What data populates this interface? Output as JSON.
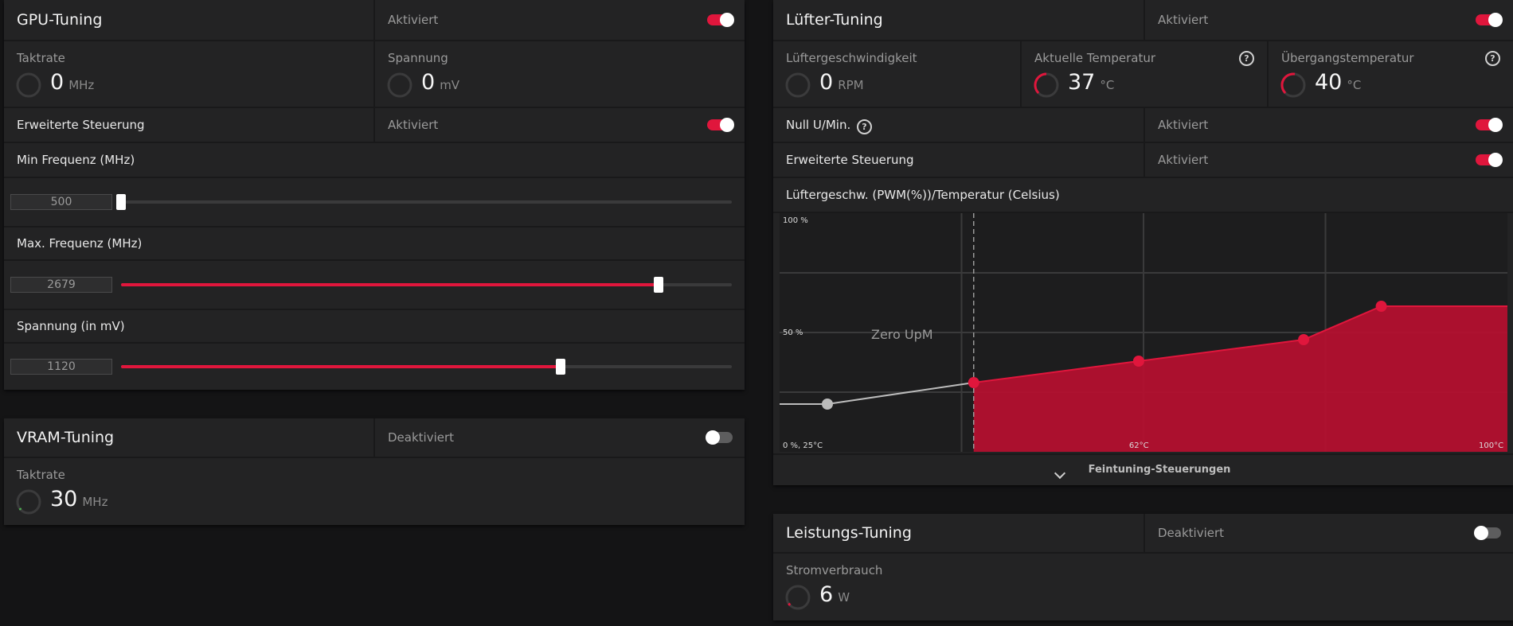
{
  "gpu": {
    "title": "GPU-Tuning",
    "status": "Aktiviert",
    "clock_label": "Taktrate",
    "clock_value": "0",
    "clock_unit": "MHz",
    "voltage_label": "Spannung",
    "voltage_value": "0",
    "voltage_unit": "mV",
    "advanced_label": "Erweiterte Steuerung",
    "advanced_status": "Aktiviert",
    "min_freq_label": "Min Frequenz (MHz)",
    "min_freq_value": "500",
    "min_freq_fraction": 0.0,
    "max_freq_label": "Max. Frequenz (MHz)",
    "max_freq_value": "2679",
    "max_freq_fraction": 0.88,
    "volt_slider_label": "Spannung (in mV)",
    "volt_slider_value": "1120",
    "volt_slider_fraction": 0.72
  },
  "vram": {
    "title": "VRAM-Tuning",
    "status": "Deaktiviert",
    "clock_label": "Taktrate",
    "clock_value": "30",
    "clock_unit": "MHz"
  },
  "fan": {
    "title": "Lüfter-Tuning",
    "status": "Aktiviert",
    "speed_label": "Lüftergeschwindigkeit",
    "speed_value": "0",
    "speed_unit": "RPM",
    "temp_label": "Aktuelle Temperatur",
    "temp_value": "37",
    "temp_unit": "°C",
    "junction_label": "Übergangstemperatur",
    "junction_value": "40",
    "junction_unit": "°C",
    "zero_rpm_label": "Null U/Min.",
    "zero_rpm_status": "Aktiviert",
    "advanced_label": "Erweiterte Steuerung",
    "advanced_status": "Aktiviert",
    "curve_label": "Lüftergeschw. (PWM(%))/Temperatur (Celsius)",
    "fine_tuning_label": "Feintuning-Steuerungen"
  },
  "power": {
    "title": "Leistungs-Tuning",
    "status": "Deaktiviert",
    "consumption_label": "Stromverbrauch",
    "consumption_value": "6",
    "consumption_unit": "W"
  },
  "chart_data": {
    "type": "area",
    "x_min": 25,
    "x_max": 100,
    "y_min": 0,
    "y_max": 100,
    "grid": true,
    "y_ticks": [
      "100 %",
      "50 %"
    ],
    "origin_label": "0 %, 25°C",
    "x_tick_labels": [
      "62°C",
      "100°C"
    ],
    "zero_rpm_text": "Zero UpM",
    "zero_rpm_threshold": 45,
    "zero_rpm_point": {
      "x": 25,
      "y": 20
    },
    "points": [
      {
        "x": 45,
        "y": 29
      },
      {
        "x": 62,
        "y": 38
      },
      {
        "x": 79,
        "y": 47
      },
      {
        "x": 87,
        "y": 61
      }
    ],
    "colors": {
      "curve": "#e0163c",
      "fill": "#b3102f",
      "inactive": "#bcbcbc"
    }
  }
}
